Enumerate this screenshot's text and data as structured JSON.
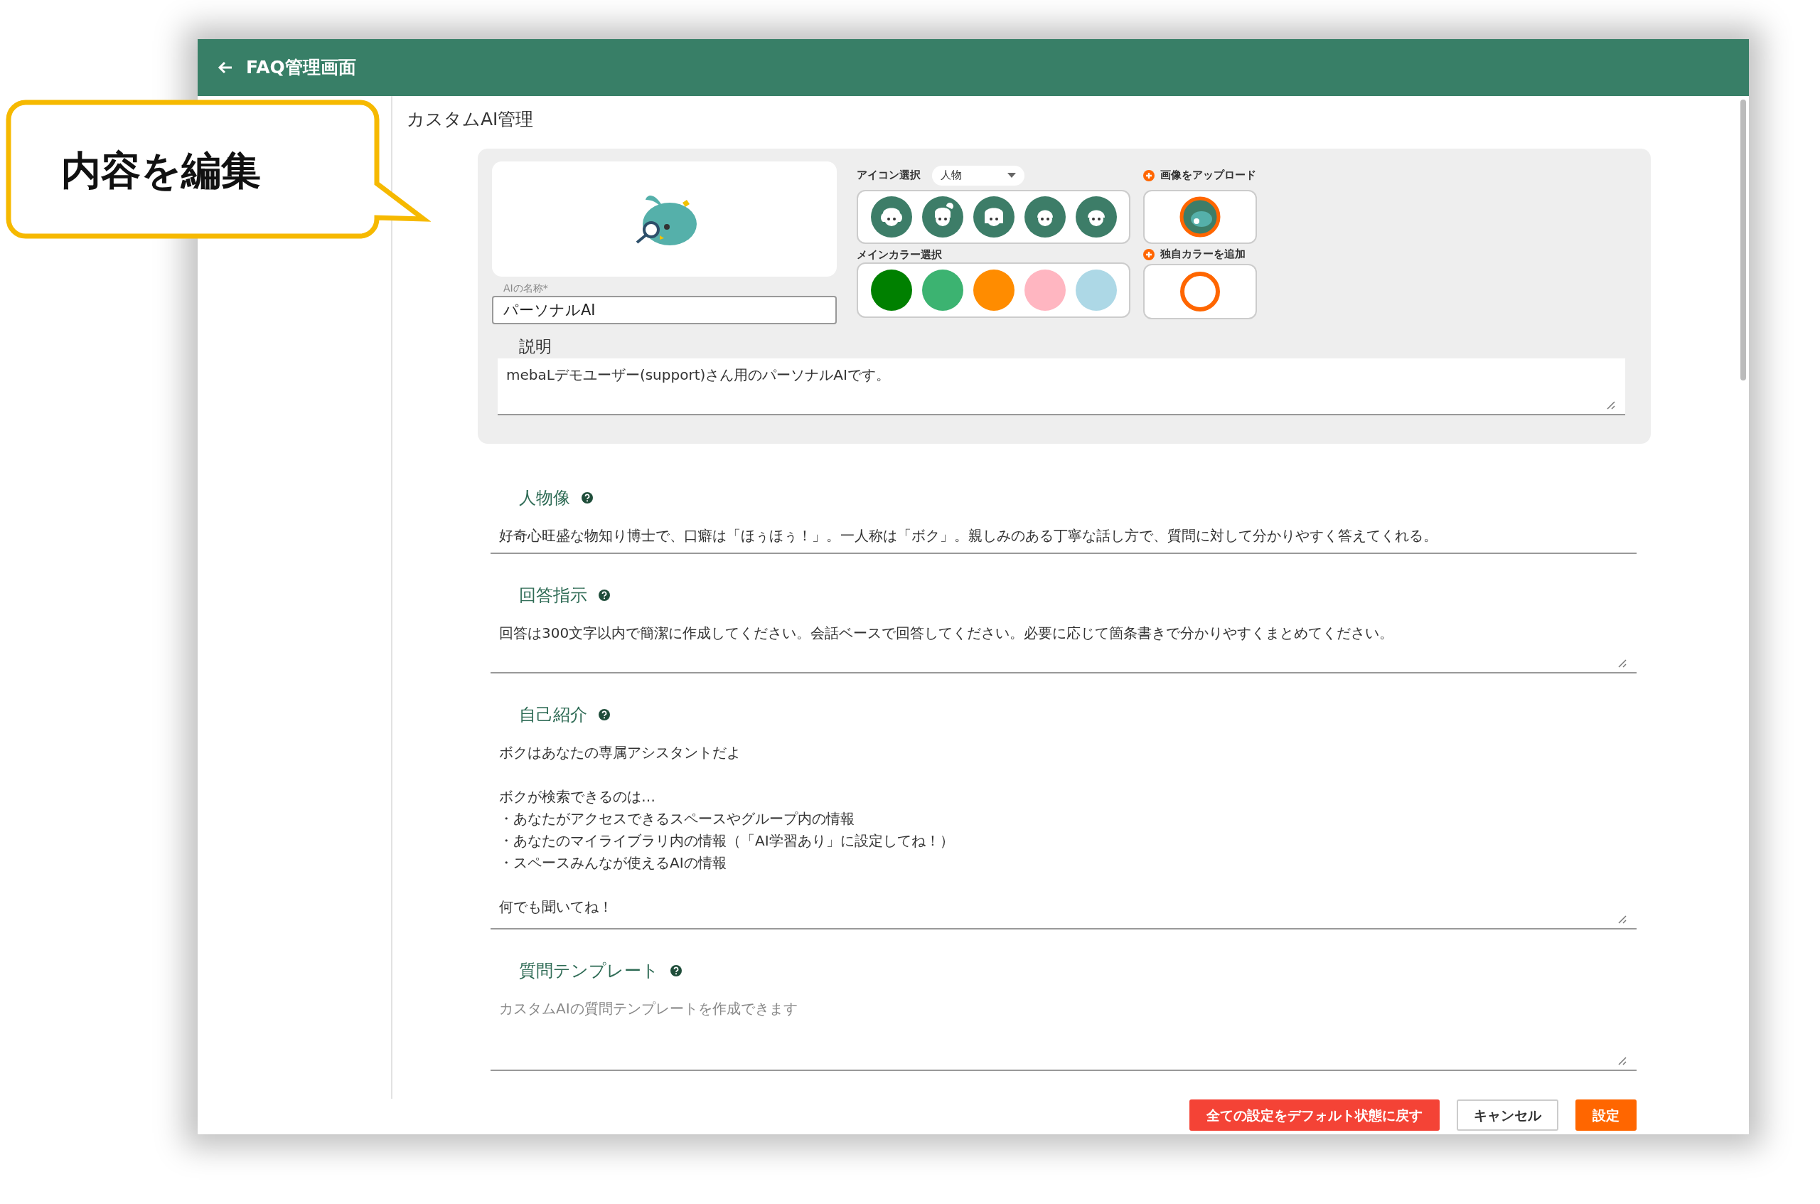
{
  "header": {
    "title": "FAQ管理画面"
  },
  "page_title": "カスタムAI管理",
  "callout": {
    "text": "内容を編集"
  },
  "name_field": {
    "label": "AIの名称*",
    "value": "パーソナルAI"
  },
  "icon_select": {
    "label": "アイコン選択",
    "dropdown": "人物",
    "icons": [
      {
        "kind": "curly"
      },
      {
        "kind": "bun"
      },
      {
        "kind": "bob"
      },
      {
        "kind": "short"
      },
      {
        "kind": "round"
      }
    ]
  },
  "color_select": {
    "label": "メインカラー選択",
    "colors": [
      {
        "color": "#008000"
      },
      {
        "color": "#3cb371"
      },
      {
        "color": "#ff8c00"
      },
      {
        "color": "#ffb6c1"
      },
      {
        "color": "#add8e6"
      }
    ]
  },
  "upload": {
    "label": "画像をアップロード",
    "selected": true
  },
  "custom_color": {
    "label": "独自カラーを追加",
    "color": "#ff6600"
  },
  "description": {
    "label": "説明",
    "value": "mebaLデモユーザー(support)さん用のパーソナルAIです。"
  },
  "sections": [
    {
      "label": "人物像",
      "kind": "input",
      "value": "好奇心旺盛な物知り博士で、口癖は「ほぅほぅ！」。一人称は「ボク」。親しみのある丁寧な話し方で、質問に対して分かりやすく答えてくれる。"
    },
    {
      "label": "回答指示",
      "kind": "textarea",
      "value": "回答は300文字以内で簡潔に作成してください。会話ベースで回答してください。必要に応じて箇条書きで分かりやすくまとめてください。"
    },
    {
      "label": "自己紹介",
      "kind": "multiline",
      "paragraphs": [
        [
          "ボクはあなたの専属アシスタントだよ"
        ],
        [
          "ボクが検索できるのは…",
          "・あなたがアクセスできるスペースやグループ内の情報",
          "・あなたのマイライブラリ内の情報（「AI学習あり」に設定してね！）",
          "・スペースみんなが使えるAIの情報"
        ],
        [
          "何でも聞いてね！"
        ]
      ]
    },
    {
      "label": "質問テンプレート",
      "kind": "textarea",
      "placeholder": "カスタムAIの質問テンプレートを作成できます"
    }
  ],
  "buttons": [
    {
      "label": "全ての設定をデフォルト状態に戻す",
      "kind": "danger"
    },
    {
      "label": "キャンセル",
      "kind": "secondary"
    },
    {
      "label": "設定",
      "kind": "primary"
    }
  ]
}
